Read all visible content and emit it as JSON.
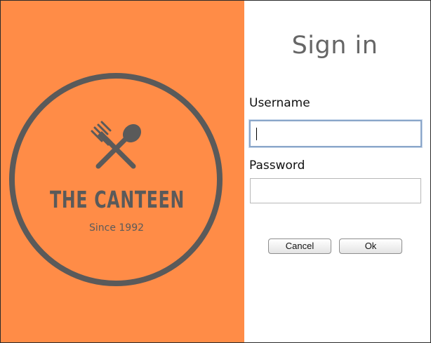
{
  "branding": {
    "name": "THE CANTEEN",
    "tagline": "Since 1992",
    "background_color": "#FF8C47",
    "logo_color": "#5a5a5a",
    "icon": "fork-and-spoon-icon"
  },
  "form": {
    "title": "Sign in",
    "username_label": "Username",
    "username_value": "",
    "password_label": "Password",
    "password_value": ""
  },
  "buttons": {
    "cancel_label": "Cancel",
    "ok_label": "Ok"
  }
}
